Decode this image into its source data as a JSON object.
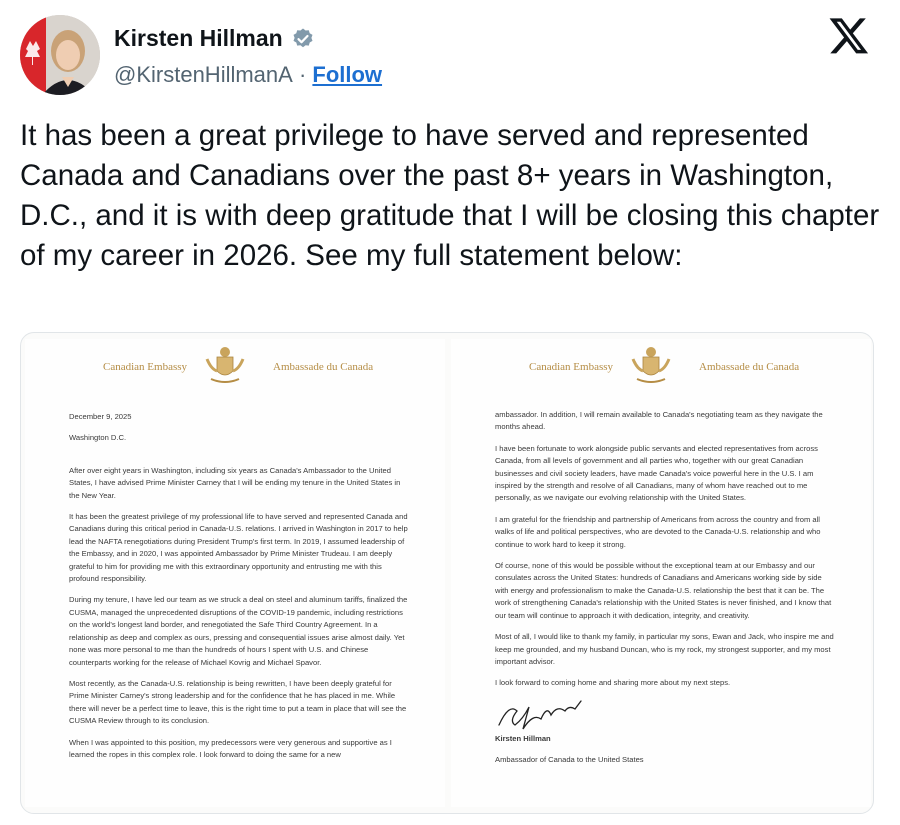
{
  "author": {
    "name": "Kirsten Hillman",
    "handle": "@KirstenHillmanA",
    "separator": " · ",
    "follow_label": "Follow"
  },
  "icons": {
    "verified": "verified-badge-icon",
    "platform": "x-logo-icon"
  },
  "colors": {
    "follow_link": "#1d6fd1",
    "verified_badge": "#829aab",
    "letterhead_gold": "#b58d45"
  },
  "tweet": {
    "text": "It has been a great privilege to have served and represented Canada and Canadians over the past 8+ years in Washington, D.C., and it is with deep gratitude that I will be closing this chapter of my career in 2026. See my full statement below:"
  },
  "letter": {
    "letterhead_left": "Canadian Embassy",
    "letterhead_right": "Ambassade du Canada",
    "page1": {
      "date": "December 9, 2025",
      "place": "Washington D.C.",
      "paragraphs": [
        "After over eight years in Washington, including six years as Canada's Ambassador to the United States, I have advised Prime Minister Carney that I will be ending my tenure in the United States in the New Year.",
        "It has been the greatest privilege of my professional life to have served and represented Canada and Canadians during this critical period in Canada-U.S. relations. I arrived in Washington in 2017 to help lead the NAFTA renegotiations during President Trump's first term. In 2019, I assumed leadership of the Embassy, and in 2020, I was appointed Ambassador by Prime Minister Trudeau. I am deeply grateful to him for providing me with this extraordinary opportunity and entrusting me with this profound responsibility.",
        "During my tenure, I have led our team as we struck a deal on steel and aluminum tariffs, finalized the CUSMA, managed the unprecedented disruptions of the COVID-19 pandemic, including restrictions on the world's longest land border, and renegotiated the Safe Third Country Agreement. In a relationship as deep and complex as ours, pressing and consequential issues arise almost daily. Yet none was more personal to me than the hundreds of hours I spent with U.S. and Chinese counterparts working for the release of Michael Kovrig and Michael Spavor.",
        "Most recently, as the Canada-U.S. relationship is being rewritten, I have been deeply grateful for Prime Minister Carney's strong leadership and for the confidence that he has placed in me. While there will never be a perfect time to leave, this is the right time to put a team in place that will see the CUSMA Review through to its conclusion.",
        "When I was appointed to this position, my predecessors were very generous and supportive as I learned the ropes in this complex role. I look forward to doing the same for a new"
      ]
    },
    "page2": {
      "paragraphs": [
        "ambassador. In addition, I will remain available to Canada's negotiating team as they navigate the months ahead.",
        "I have been fortunate to work alongside public servants and elected representatives from across Canada, from all levels of government and all parties who, together with our great Canadian businesses and civil society leaders, have made Canada's voice powerful here in the U.S. I am inspired by the strength and resolve of all Canadians, many of whom have reached out to me personally, as we navigate our evolving relationship with the United States.",
        "I am grateful for the friendship and partnership of Americans from across the country and from all walks of life and political perspectives, who are devoted to the Canada-U.S. relationship and who continue to work hard to keep it strong.",
        "Of course, none of this would be possible without the exceptional team at our Embassy and our consulates across the United States: hundreds of Canadians and Americans working side by side with energy and professionalism to make the Canada-U.S. relationship the best that it can be. The work of strengthening Canada's relationship with the United States is never finished, and I know that our team will continue to approach it with dedication, integrity, and creativity.",
        "Most of all, I would like to thank my family, in particular my sons, Ewan and Jack, who inspire me and keep me grounded, and my husband Duncan, who is my rock, my strongest supporter, and my most important advisor.",
        "I look forward to coming home and sharing more about my next steps."
      ],
      "signatory": "Kirsten Hillman",
      "signatory_title": "Ambassador of Canada to the United States"
    }
  }
}
